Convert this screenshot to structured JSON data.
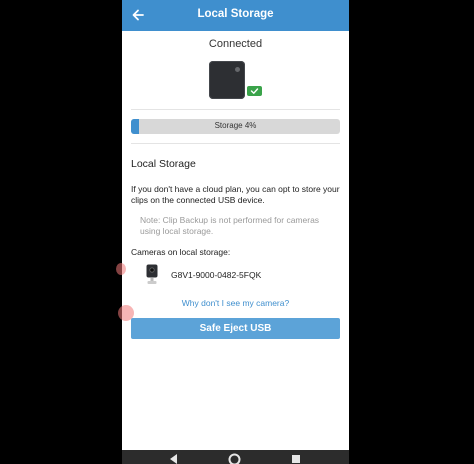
{
  "appbar": {
    "title": "Local Storage",
    "back_icon": "arrow-left-icon"
  },
  "status": {
    "text": "Connected",
    "device_icon": "usb-base-station-icon",
    "badge_icon": "check-icon",
    "badge_color": "#3aa34a"
  },
  "storage": {
    "label": "Storage 4%",
    "percent": 4,
    "bar_color": "#3f8fce"
  },
  "section": {
    "heading": "Local Storage",
    "description": "If you don't have a cloud plan, you can opt to store your clips on the connected USB device.",
    "note": "Note: Clip Backup is not performed for cameras using local storage."
  },
  "cameras": {
    "heading": "Cameras on local storage:",
    "items": [
      {
        "id": "G8V1-9000-0482-5FQK",
        "icon": "camera-icon"
      }
    ]
  },
  "help_link": "Why don't I see my camera?",
  "eject_button": "Safe Eject USB",
  "colors": {
    "accent": "#3f8fce",
    "button": "#5ca3d8"
  }
}
